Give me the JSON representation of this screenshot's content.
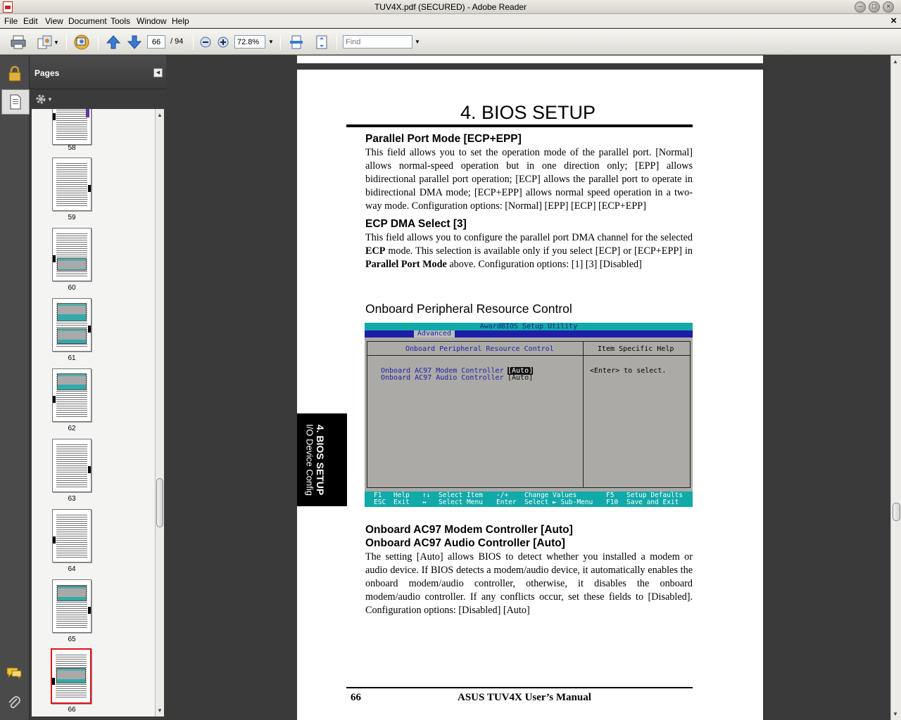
{
  "window": {
    "title": "TUV4X.pdf (SECURED) - Adobe Reader"
  },
  "menu": [
    "File",
    "Edit",
    "View",
    "Document",
    "Tools",
    "Window",
    "Help"
  ],
  "toolbar": {
    "page_current": "66",
    "page_total": "/ 94",
    "zoom": "72.8%",
    "find_placeholder": "Find"
  },
  "pages_panel": {
    "title": "Pages",
    "thumbnails": [
      {
        "label": "58"
      },
      {
        "label": "59"
      },
      {
        "label": "60"
      },
      {
        "label": "61"
      },
      {
        "label": "62"
      },
      {
        "label": "63"
      },
      {
        "label": "64"
      },
      {
        "label": "65"
      },
      {
        "label": "66",
        "selected": true
      }
    ]
  },
  "page": {
    "heading": "4. BIOS SETUP",
    "side_tab": {
      "line1": "4. BIOS SETUP",
      "line2": "I/O Device Config"
    },
    "sec1_title": "Parallel Port Mode [ECP+EPP]",
    "sec1_body": "This field allows you to set the operation mode of the parallel port. [Normal] allows normal-speed operation but in one direction only; [EPP] allows bidirectional parallel port operation; [ECP] allows the parallel port to operate in bidirectional DMA mode; [ECP+EPP] allows normal speed operation in a two-way mode. Configuration options: [Normal] [EPP] [ECP] [ECP+EPP]",
    "sec2_title": "ECP DMA Select [3]",
    "sec2_body_a": "This field allows you to configure the parallel port DMA channel for the selected ",
    "sec2_body_b": "ECP",
    "sec2_body_c": " mode. This selection is available only if you select [ECP] or [ECP+EPP] in ",
    "sec2_body_d": "Parallel Port Mode",
    "sec2_body_e": " above. Configuration options: [1] [3] [Disabled]",
    "sec3_title": "Onboard Peripheral Resource Control",
    "sec4_title_a": "Onboard AC97 Modem Controller [Auto]",
    "sec4_title_b": "Onboard AC97 Audio Controller [Auto]",
    "sec4_body": "The setting [Auto] allows BIOS to detect whether you installed a modem or audio device. If BIOS detects a modem/audio device, it automatically enables the onboard modem/audio controller, otherwise, it disables the onboard modem/audio controller. If any conflicts occur, set these fields to [Disabled]. Configuration options: [Disabled] [Auto]",
    "footer_num": "66",
    "footer_title": "ASUS TUV4X User’s Manual"
  },
  "bios": {
    "utility_title": "AwardBIOS Setup Utility",
    "tab": "Advanced",
    "panel_title": "Onboard Peripheral Resource Control",
    "help_title": "Item Specific Help",
    "options": [
      {
        "label": "Onboard AC97 Modem Controller",
        "value": "[Auto]"
      },
      {
        "label": "Onboard AC97 Audio Controller",
        "value": "[Auto]"
      }
    ],
    "help_text": "<Enter> to select.",
    "footer": {
      "k1": "F1",
      "k1t": "Help",
      "k2": "ESC",
      "k2t": "Exit",
      "k3": "↑↓",
      "k3t": "Select Item",
      "k4": "↔",
      "k4t": "Select Menu",
      "k5": "-/+",
      "k5t": "Change Values",
      "k6": "Enter",
      "k6t": "Select ► Sub-Menu",
      "k7": "F5",
      "k7t": "Setup Defaults",
      "k8": "F10",
      "k8t": "Save and Exit"
    }
  },
  "colors": {
    "bios_cyan": "#12a9a9",
    "bios_blue": "#1d1da8",
    "selected_thumb": "#e3131a"
  }
}
